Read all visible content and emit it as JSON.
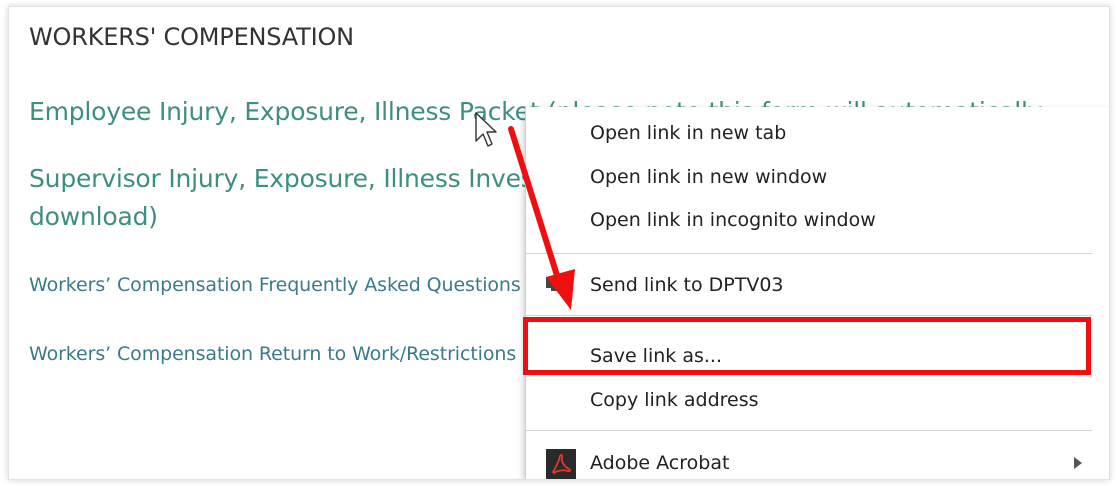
{
  "section": {
    "heading": "WORKERS' COMPENSATION"
  },
  "links": {
    "employee_packet": "Employee Injury, Exposure, Illness Packet (please note this form will automatically",
    "supervisor_line1": "Supervisor Injury, Exposure, Illness Investigation Report (please note this form will auto",
    "supervisor_line2": "download)",
    "faq": "Workers’ Compensation Frequently Asked Questions",
    "return_to_work": "Workers’ Compensation Return to Work/Restrictions"
  },
  "context_menu": {
    "open_new_tab": "Open link in new tab",
    "open_new_window": "Open link in new window",
    "open_incognito": "Open link in incognito window",
    "send_link": "Send link to DPTV03",
    "save_link_as": "Save link as...",
    "copy_link_address": "Copy link address",
    "adobe_acrobat": "Adobe Acrobat"
  },
  "colors": {
    "link_large": "#3e8e82",
    "link_small": "#3a7a8c",
    "annotation_red": "#f00f0f"
  },
  "icons": {
    "cursor": "mouse-pointer-icon",
    "send": "send-to-device-icon",
    "acrobat": "adobe-acrobat-icon",
    "submenu": "submenu-arrow-icon"
  }
}
